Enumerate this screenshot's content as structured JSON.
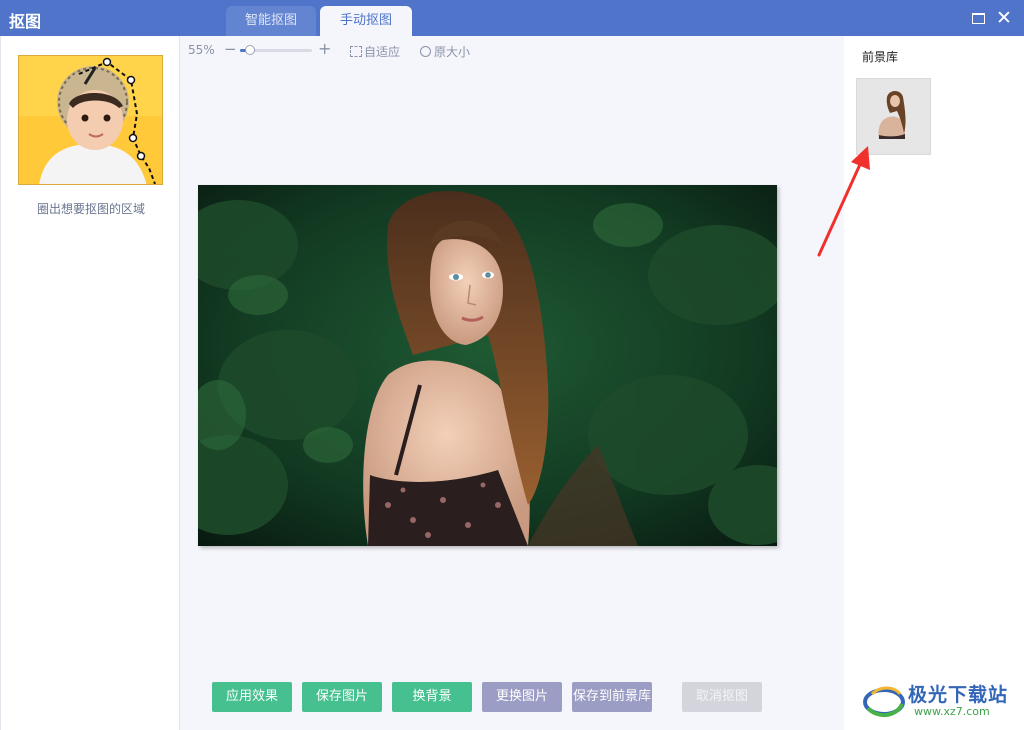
{
  "window": {
    "title": "抠图",
    "tabs": [
      {
        "label": "智能抠图",
        "active": false
      },
      {
        "label": "手动抠图",
        "active": true
      }
    ],
    "close_glyph": "✕"
  },
  "left_panel": {
    "hint": "圈出想要抠图的区域"
  },
  "toolbar": {
    "zoom_percent": "55%",
    "zoom_level": 0.14,
    "fit_label": "自适应",
    "original_size_label": "原大小"
  },
  "buttons": [
    {
      "label": "应用效果",
      "style": "green"
    },
    {
      "label": "保存图片",
      "style": "green"
    },
    {
      "label": "换背景",
      "style": "green"
    },
    {
      "label": "更换图片",
      "style": "purple"
    },
    {
      "label": "保存到前景库",
      "style": "purple"
    },
    {
      "label": "取消抠图",
      "style": "disabled"
    }
  ],
  "right_panel": {
    "title": "前景库"
  },
  "watermark": {
    "name": "极光下载站",
    "url": "www.xz7.com"
  },
  "colors": {
    "titlebar": "#4f74c9",
    "green_button": "#46c08f",
    "purple_button": "#9c9dc4",
    "annotation_arrow": "#f0302c"
  }
}
